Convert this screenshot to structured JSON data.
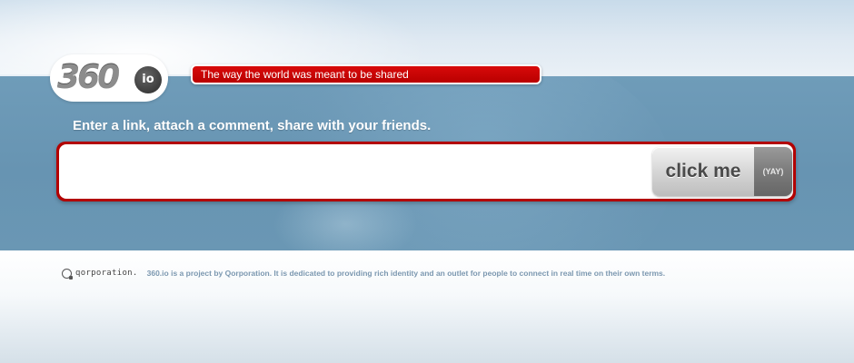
{
  "logo": {
    "text_main": "360",
    "text_badge": "io"
  },
  "tagline": "The way the world was meant to be shared",
  "prompt": "Enter a link, attach a comment, share with your friends.",
  "link_input": {
    "value": "",
    "placeholder": ""
  },
  "submit_button": {
    "label": "click me",
    "badge": "(YAY)"
  },
  "footer": {
    "brand": "qorporation.",
    "text": "360.io is a project by Qorporation. It is dedicated to providing rich identity and an outlet for people to connect in real time on their own terms."
  },
  "colors": {
    "accent_red": "#c40000",
    "band_blue": "#6794b2",
    "footer_text": "#7c98b0"
  },
  "icons": {
    "footer_logo": "qorporation-logo-icon"
  }
}
